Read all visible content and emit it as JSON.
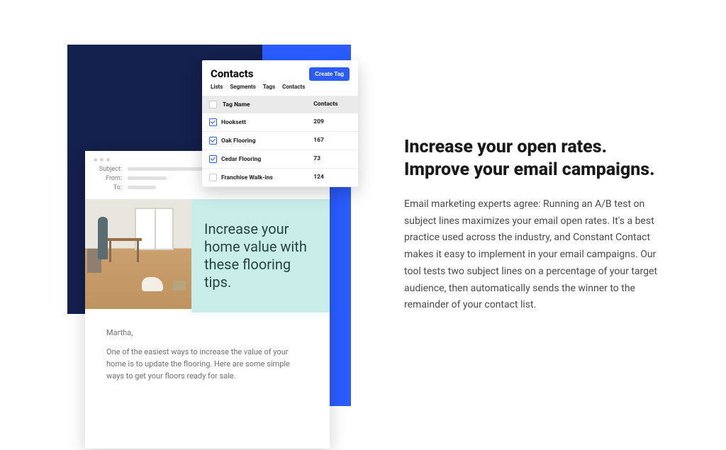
{
  "contacts": {
    "title": "Contacts",
    "create_label": "Create Tag",
    "tabs": [
      "Lists",
      "Segments",
      "Tags",
      "Contacts"
    ],
    "columns": {
      "name": "Tag Name",
      "count": "Contacts"
    },
    "rows": [
      {
        "name": "Hooksett",
        "count": "209",
        "checked": true
      },
      {
        "name": "Oak Flooring",
        "count": "167",
        "checked": true
      },
      {
        "name": "Cedar Flooring",
        "count": "73",
        "checked": true
      },
      {
        "name": "Franchise Walk-ins",
        "count": "124",
        "checked": false
      }
    ]
  },
  "email_preview": {
    "meta": {
      "subject_label": "Subject:",
      "from_label": "From:",
      "to_label": "To:"
    },
    "hero_heading": "Increase your home value with these flooring tips.",
    "greeting": "Martha,",
    "body": "One of the easiest ways to increase the value of your home is to update the flooring. Here are some simple ways to get your floors ready for sale."
  },
  "marketing": {
    "heading": "Increase your open rates. Improve your email campaigns.",
    "body": "Email marketing experts agree: Running an A/B test on subject lines maximizes your email open rates. It's a best practice used across the industry, and Constant Contact makes it easy to implement in your email campaigns. Our tool tests two subject lines on a percentage of your target audience, then automatically sends the winner to the remainder of your contact list."
  }
}
